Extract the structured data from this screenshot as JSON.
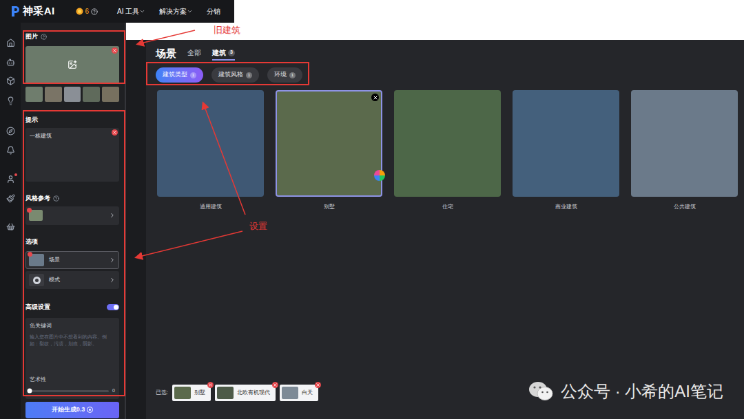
{
  "app": {
    "logo": "神采AI",
    "coins": "6",
    "menu": [
      {
        "label": "AI 工具",
        "has_dropdown": true
      },
      {
        "label": "解决方案",
        "has_dropdown": true
      },
      {
        "label": "分销",
        "has_dropdown": false
      }
    ]
  },
  "nav": [
    {
      "has_dot": false
    },
    {
      "has_dot": false
    },
    {
      "has_dot": false
    },
    {
      "has_dot": false
    },
    {
      "has_dot": false
    },
    {
      "has_dot": false
    },
    {
      "has_dot": true
    },
    {
      "has_dot": false
    },
    {
      "has_dot": false
    }
  ],
  "left_panel": {
    "image": {
      "title": "图片",
      "thumbnails": [
        {
          "selected": false
        },
        {
          "selected": false
        },
        {
          "selected": false
        },
        {
          "selected": false
        },
        {
          "selected": false
        }
      ]
    },
    "prompt": {
      "title": "提示",
      "value": "一栋建筑"
    },
    "style_reference": {
      "title": "风格参考"
    },
    "options": {
      "title": "选项",
      "items": [
        {
          "label": "场景",
          "kind": "thumbnail",
          "selected": true
        },
        {
          "label": "模式",
          "kind": "icon",
          "selected": false
        }
      ]
    },
    "advanced": {
      "title": "高级设置",
      "on": true
    },
    "negative": {
      "label": "负关键词",
      "placeholder": "输入您在图片中不想看到的内容。例如：裂纹，污渍，划痕，阴影。"
    },
    "artistry": {
      "label": "艺术性",
      "level": 0,
      "reading": "0"
    },
    "generate_button": {
      "label": "开始生成0.3"
    }
  },
  "scene": {
    "title": "场景",
    "tabs": [
      {
        "label": "全部",
        "count": "",
        "selected": false
      },
      {
        "label": "建筑",
        "count": "3",
        "selected": true
      }
    ],
    "subtabs": [
      {
        "label": "建筑类型",
        "count": "1",
        "selected": true
      },
      {
        "label": "建筑风格",
        "count": "1",
        "selected": false
      },
      {
        "label": "环境",
        "count": "1",
        "selected": false
      }
    ],
    "cards": [
      {
        "label": "通用建筑",
        "selected": false
      },
      {
        "label": "别墅",
        "selected": true
      },
      {
        "label": "住宅",
        "selected": false
      },
      {
        "label": "商业建筑",
        "selected": false
      },
      {
        "label": "公共建筑",
        "selected": false
      }
    ],
    "selected_label": "已选:",
    "chips": [
      {
        "label": "别墅"
      },
      {
        "label": "北欧有机现代"
      },
      {
        "label": "白天"
      }
    ]
  },
  "annotations": [
    {
      "label": "旧建筑"
    },
    {
      "label": "设置"
    }
  ],
  "watermark": "公众号 · 小希的AI笔记"
}
